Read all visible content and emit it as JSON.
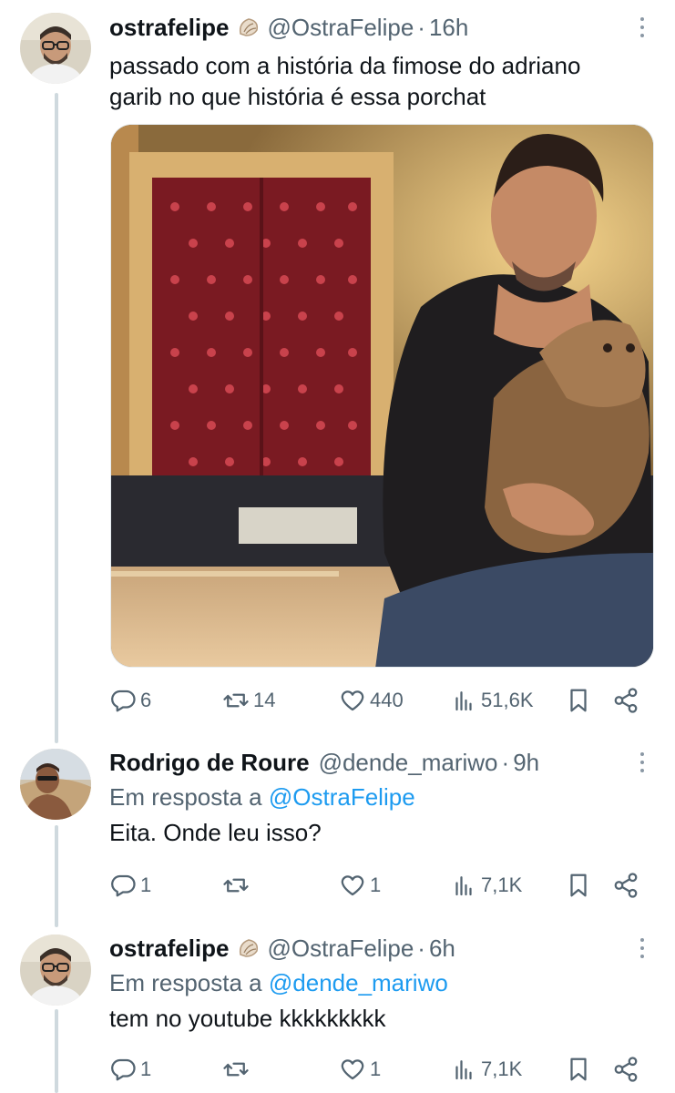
{
  "colors": {
    "text": "#0f1419",
    "secondary": "#536471",
    "link": "#1d9bf0",
    "line": "#cfd9de"
  },
  "tweets": [
    {
      "name": "ostrafelipe",
      "handle": "@OstraFelipe",
      "dot": "·",
      "time": "16h",
      "text_line1": "passado com a história da fimose do adriano",
      "text_line2": "garib no que história é essa porchat",
      "media": {
        "icon": "photo-man-holding-cat"
      },
      "stats": {
        "replies": "6",
        "reposts": "14",
        "likes": "440",
        "views": "51,6K"
      }
    },
    {
      "name": "Rodrigo de Roure",
      "handle": "@dende_mariwo",
      "dot": "·",
      "time": "9h",
      "replying_prefix": "Em resposta a",
      "replying_to": "@OstraFelipe",
      "text": "Eita. Onde leu isso?",
      "stats": {
        "replies": "1",
        "reposts": "",
        "likes": "1",
        "views": "7,1K"
      }
    },
    {
      "name": "ostrafelipe",
      "handle": "@OstraFelipe",
      "dot": "·",
      "time": "6h",
      "replying_prefix": "Em resposta a",
      "replying_to": "@dende_mariwo",
      "text": "tem no youtube kkkkkkkkk",
      "stats": {
        "replies": "1",
        "reposts": "",
        "likes": "1",
        "views": "7,1K"
      }
    }
  ]
}
